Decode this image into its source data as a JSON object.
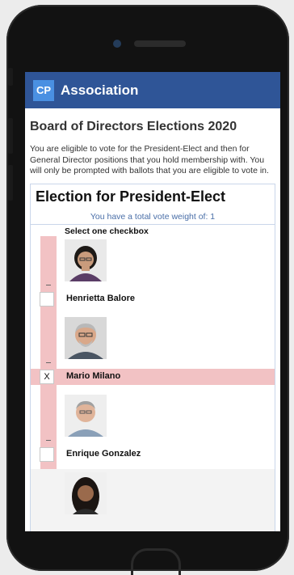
{
  "app": {
    "logo_text": "CP",
    "name": "Association"
  },
  "page": {
    "title": "Board of Directors Elections 2020",
    "intro": "You are eligible to vote for the President-Elect and then for General Director positions that you hold membership with. You will only be prompted with ballots that you are eligible to vote in."
  },
  "election": {
    "title": "Election for President-Elect",
    "vote_weight": "You have a total vote weight of: 1",
    "instruction": "Select one checkbox",
    "candidates": [
      {
        "name": "Henrietta Balore",
        "mark": ""
      },
      {
        "name": "Mario Milano",
        "mark": "X"
      },
      {
        "name": "Enrique Gonzalez",
        "mark": ""
      }
    ]
  },
  "colors": {
    "appbar": "#2f5597",
    "logo": "#4a90e2",
    "selection": "#f2c2c4"
  }
}
